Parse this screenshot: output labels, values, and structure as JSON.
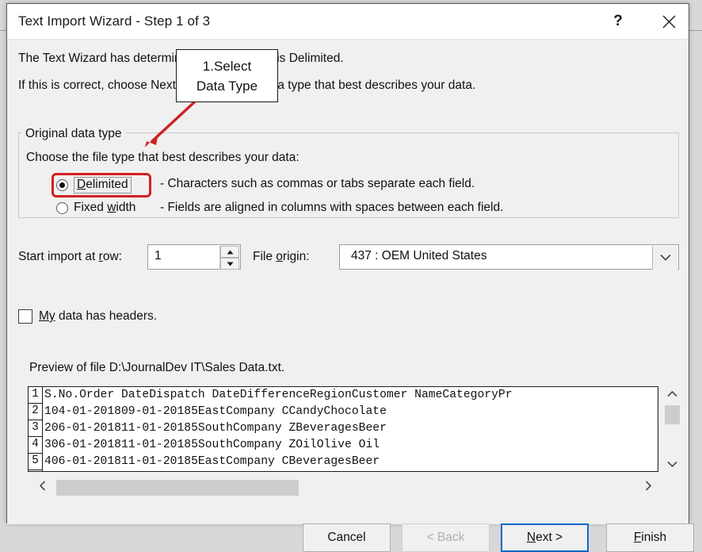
{
  "window": {
    "title": "Text Import Wizard - Step 1 of 3",
    "help_icon": "question-mark-icon",
    "close_icon": "close-x-icon"
  },
  "intro": {
    "line1": "The Text Wizard has determined that your data is Delimited.",
    "line2": "If this is correct, choose Next, or choose the data type that best describes your data."
  },
  "original_data_type": {
    "legend": "Original data type",
    "choose_label": "Choose the file type that best describes your data:",
    "options": [
      {
        "label": "Delimited",
        "label_pre": "D",
        "label_post": "elimited",
        "description": "- Characters such as commas or tabs separate each field.",
        "selected": true
      },
      {
        "label": "Fixed width",
        "label_pre": "Fixed ",
        "label_accel": "w",
        "label_post": "idth",
        "description": "- Fields are aligned in columns with spaces between each field.",
        "selected": false
      }
    ]
  },
  "start_row": {
    "label": "Start import at row:",
    "value": "1",
    "up_icon": "spinner-up-icon",
    "down_icon": "spinner-down-icon"
  },
  "file_origin": {
    "label": "File origin:",
    "value": "437 : OEM United States",
    "dropdown_icon": "chevron-down-icon"
  },
  "headers_checkbox": {
    "label": "My data has headers.",
    "label_accel": "My",
    "label_rest": " data has headers.",
    "checked": false
  },
  "preview": {
    "label": "Preview of file D:\\JournalDev IT\\Sales Data.txt.",
    "rows": [
      {
        "num": "1",
        "text": "S.No.Order DateDispatch DateDifferenceRegionCustomer NameCategoryPr"
      },
      {
        "num": "2",
        "text": "104-01-201809-01-20185EastCompany CCandyChocolate"
      },
      {
        "num": "3",
        "text": "206-01-201811-01-20185SouthCompany ZBeveragesBeer"
      },
      {
        "num": "4",
        "text": "306-01-201811-01-20185SouthCompany ZOilOlive Oil"
      },
      {
        "num": "5",
        "text": "406-01-201811-01-20185EastCompany CBeveragesBeer"
      }
    ],
    "vscroll": {
      "up_icon": "scroll-up-icon",
      "down_icon": "scroll-down-icon"
    },
    "hscroll": {
      "left_icon": "scroll-left-icon",
      "right_icon": "scroll-right-icon"
    }
  },
  "footer": {
    "cancel": "Cancel",
    "back": "< Back",
    "next_pre": "N",
    "next_post": "ext >",
    "next": "Next >",
    "finish_pre": "F",
    "finish_post": "inish",
    "finish": "Finish"
  },
  "annotation": {
    "line1": "1.Select",
    "line2": "Data Type",
    "arrow_color": "#cc2222",
    "highlight_color": "#d32020"
  }
}
